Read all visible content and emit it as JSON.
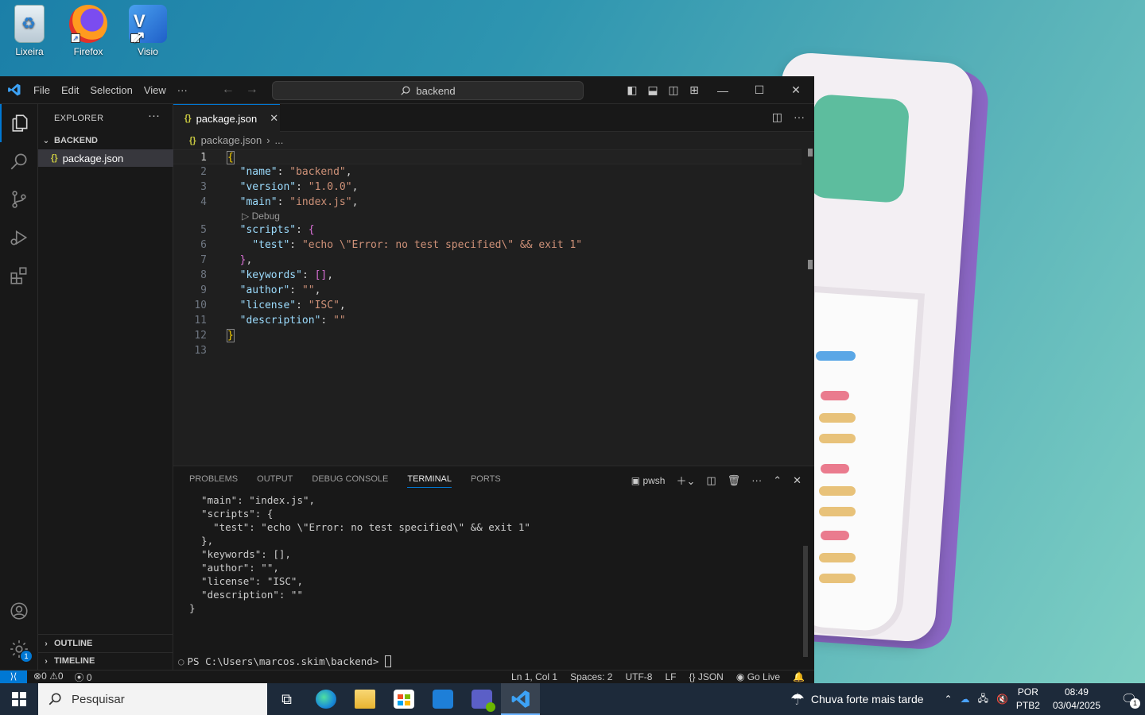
{
  "desktop": {
    "icons": [
      {
        "label": "Lixeira"
      },
      {
        "label": "Firefox"
      },
      {
        "label": "Visio"
      }
    ]
  },
  "titlebar": {
    "menu": [
      "File",
      "Edit",
      "Selection",
      "View",
      "···"
    ],
    "search": "backend"
  },
  "sidebar": {
    "title": "EXPLORER",
    "folder": "BACKEND",
    "file": "package.json",
    "outline": "OUTLINE",
    "timeline": "TIMELINE"
  },
  "activity": {
    "settings_badge": "1"
  },
  "editor": {
    "tab": "package.json",
    "breadcrumb_file": "package.json",
    "breadcrumb_more": "...",
    "codelens": "Debug",
    "lines": [
      "1",
      "2",
      "3",
      "4",
      "5",
      "6",
      "7",
      "8",
      "9",
      "10",
      "11",
      "12",
      "13"
    ]
  },
  "panel": {
    "tabs": [
      "PROBLEMS",
      "OUTPUT",
      "DEBUG CONSOLE",
      "TERMINAL",
      "PORTS"
    ],
    "shell": "pwsh",
    "terminal_lines": [
      "  \"main\": \"index.js\",",
      "  \"scripts\": {",
      "    \"test\": \"echo \\\"Error: no test specified\\\" && exit 1\"",
      "  },",
      "  \"keywords\": [],",
      "  \"author\": \"\",",
      "  \"license\": \"ISC\",",
      "  \"description\": \"\"",
      "}"
    ],
    "prompt": "PS C:\\Users\\marcos.skim\\backend>"
  },
  "statusbar": {
    "errors": "0",
    "warnings": "0",
    "ports": "0",
    "position": "Ln 1, Col 1",
    "spaces": "Spaces: 2",
    "encoding": "UTF-8",
    "eol": "LF",
    "language": "JSON",
    "golive": "Go Live"
  },
  "taskbar": {
    "search": "Pesquisar",
    "weather": "Chuva forte mais tarde",
    "lang1": "POR",
    "lang2": "PTB2",
    "time": "08:49",
    "date": "03/04/2025",
    "notif_count": "1"
  },
  "colors": {
    "accent": "#0078d4",
    "json_key": "#9cdcfe",
    "json_string": "#ce9178"
  }
}
